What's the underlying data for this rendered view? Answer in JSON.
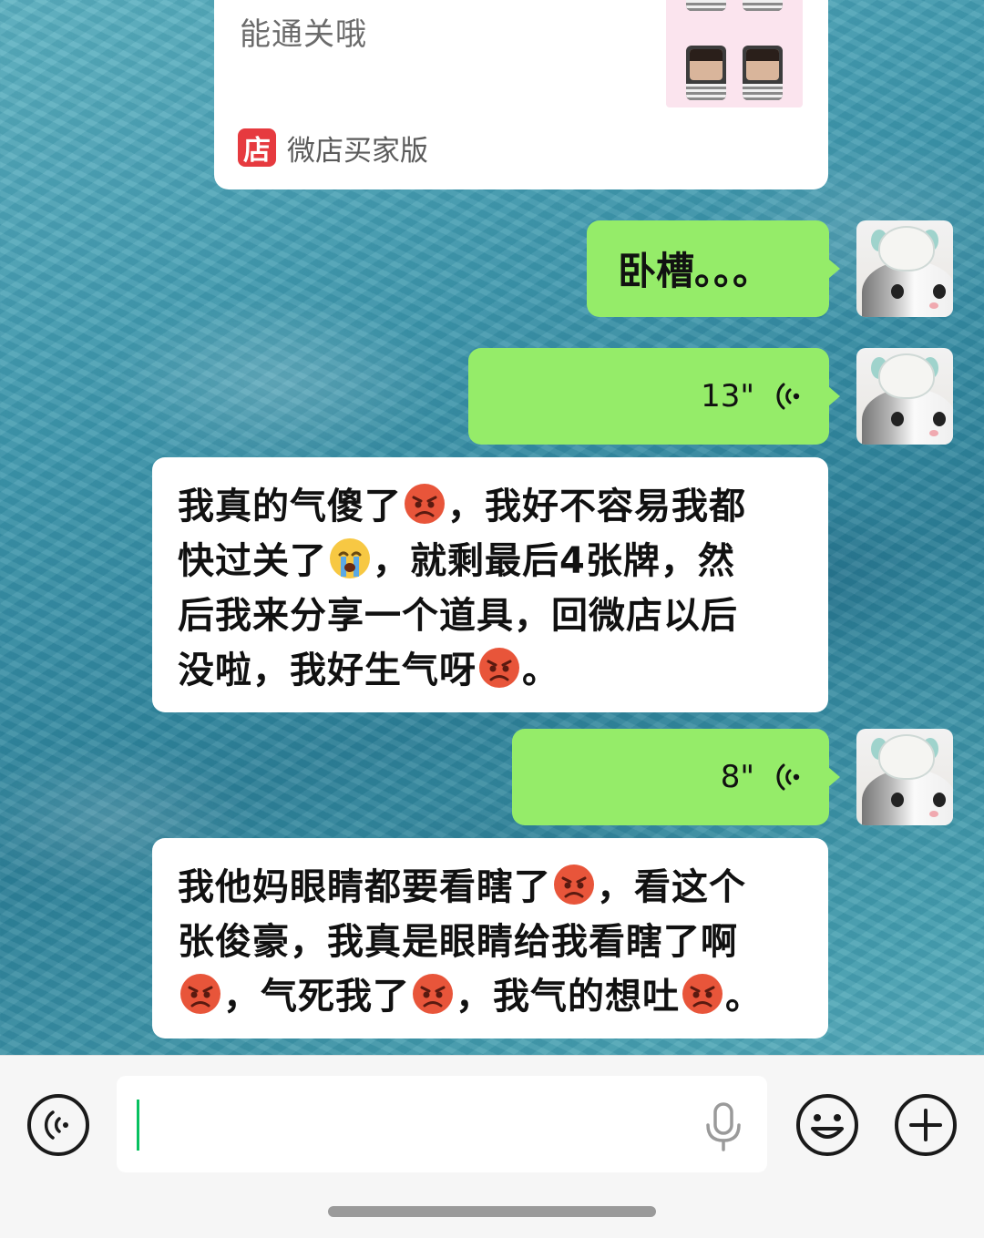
{
  "shared_card": {
    "description": "能通关哦",
    "source_icon_text": "店",
    "source_name": "微店买家版"
  },
  "messages": [
    {
      "id": "m1",
      "side": "right",
      "type": "text",
      "text": "卧槽。。。"
    },
    {
      "id": "m2",
      "side": "right",
      "type": "voice",
      "duration": "13\""
    },
    {
      "id": "m3",
      "side": "left",
      "type": "text",
      "lines": [
        [
          "我真的气傻了",
          "[angry]",
          "，我好不容易我都"
        ],
        [
          "快过关了",
          "[cry]",
          "，就剩最后4张牌，然"
        ],
        [
          "后我来分享一个道具，回微店以后"
        ],
        [
          "没啦，我好生气呀",
          "[angry]",
          "。"
        ]
      ]
    },
    {
      "id": "m4",
      "side": "right",
      "type": "voice",
      "duration": "8\""
    },
    {
      "id": "m5",
      "side": "left",
      "type": "text",
      "lines": [
        [
          "我他妈眼睛都要看瞎了",
          "[angry]",
          "，看这个"
        ],
        [
          "张俊豪，我真是眼睛给我看瞎了啊"
        ],
        [
          "[angry]",
          "，气死我了",
          "[angry]",
          "，我气的想吐",
          "[angry]",
          "。"
        ]
      ]
    }
  ],
  "input_bar": {
    "voice_toggle_icon": "voice-icon",
    "mic_icon": "mic-icon",
    "emoji_icon": "emoji-icon",
    "more_icon": "plus-icon",
    "text_value": ""
  },
  "colors": {
    "bubble_green": "#95ec69",
    "bubble_white": "#ffffff",
    "shop_red": "#e63a3f",
    "caret_green": "#07c160"
  }
}
